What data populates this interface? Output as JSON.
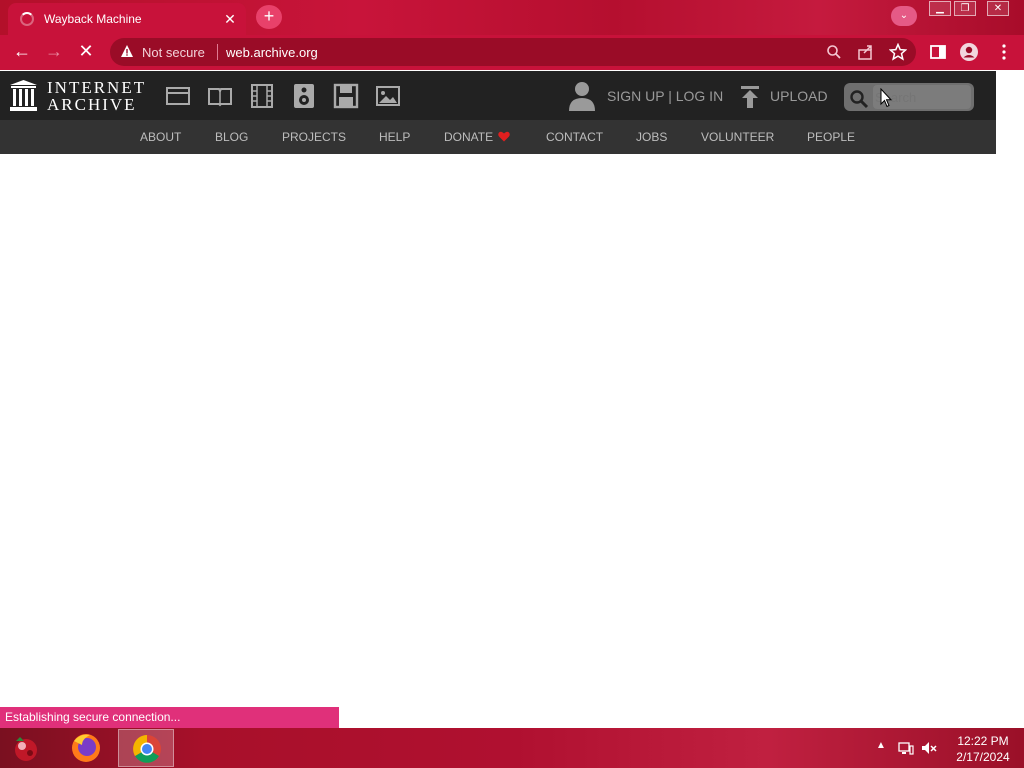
{
  "browser": {
    "tab_title": "Wayback Machine",
    "tab_close": "✕",
    "new_tab": "+",
    "omnibox": {
      "security_label": "Not secure",
      "url": "web.archive.org"
    }
  },
  "ia": {
    "logo_line1": "INTERNET",
    "logo_line2": "ARCHIVE",
    "media_icons": [
      "web-icon",
      "texts-icon",
      "video-icon",
      "audio-icon",
      "software-icon",
      "images-icon"
    ],
    "signup_login": "SIGN UP | LOG IN",
    "upload": "UPLOAD",
    "search_placeholder": "Search",
    "nav": [
      "ABOUT",
      "BLOG",
      "PROJECTS",
      "HELP",
      "DONATE",
      "CONTACT",
      "JOBS",
      "VOLUNTEER",
      "PEOPLE"
    ]
  },
  "status": {
    "text": "Establishing secure connection..."
  },
  "taskbar": {
    "time": "12:22 PM",
    "date": "2/17/2024"
  },
  "colors": {
    "browser_chrome": "#c8123a",
    "ia_header": "#222222",
    "ia_nav": "#333333",
    "status_bubble": "#e0307a"
  }
}
